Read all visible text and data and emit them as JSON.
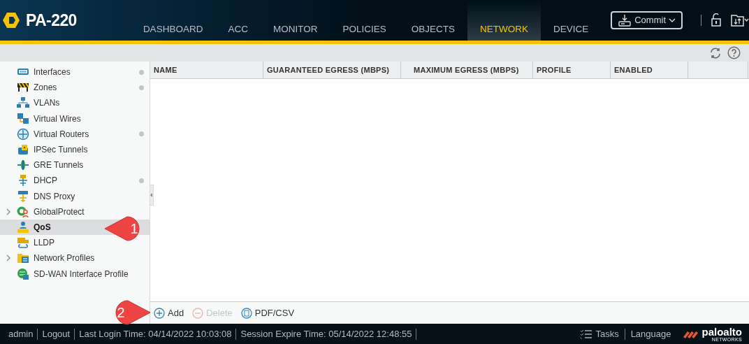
{
  "header": {
    "device": "PA-220",
    "tabs": [
      {
        "label": "DASHBOARD",
        "selected": false
      },
      {
        "label": "ACC",
        "selected": false
      },
      {
        "label": "MONITOR",
        "selected": false
      },
      {
        "label": "POLICIES",
        "selected": false
      },
      {
        "label": "OBJECTS",
        "selected": false
      },
      {
        "label": "NETWORK",
        "selected": true
      },
      {
        "label": "DEVICE",
        "selected": false
      }
    ],
    "commit": "Commit"
  },
  "sidebar": {
    "items": [
      {
        "label": "Interfaces",
        "selected": false,
        "expandable": false,
        "dot": true
      },
      {
        "label": "Zones",
        "selected": false,
        "expandable": false,
        "dot": true
      },
      {
        "label": "VLANs",
        "selected": false,
        "expandable": false,
        "dot": false
      },
      {
        "label": "Virtual Wires",
        "selected": false,
        "expandable": false,
        "dot": false
      },
      {
        "label": "Virtual Routers",
        "selected": false,
        "expandable": false,
        "dot": true
      },
      {
        "label": "IPSec Tunnels",
        "selected": false,
        "expandable": false,
        "dot": false
      },
      {
        "label": "GRE Tunnels",
        "selected": false,
        "expandable": false,
        "dot": false
      },
      {
        "label": "DHCP",
        "selected": false,
        "expandable": false,
        "dot": true
      },
      {
        "label": "DNS Proxy",
        "selected": false,
        "expandable": false,
        "dot": false
      },
      {
        "label": "GlobalProtect",
        "selected": false,
        "expandable": true,
        "dot": false
      },
      {
        "label": "QoS",
        "selected": true,
        "expandable": false,
        "dot": false
      },
      {
        "label": "LLDP",
        "selected": false,
        "expandable": false,
        "dot": false
      },
      {
        "label": "Network Profiles",
        "selected": false,
        "expandable": true,
        "dot": false
      },
      {
        "label": "SD-WAN Interface Profile",
        "selected": false,
        "expandable": false,
        "dot": false
      }
    ]
  },
  "table": {
    "columns": [
      "NAME",
      "GUARANTEED EGRESS (MBPS)",
      "MAXIMUM EGRESS (MBPS)",
      "PROFILE",
      "ENABLED"
    ]
  },
  "actions": [
    {
      "kind": "add",
      "label": "Add",
      "disabled": false
    },
    {
      "kind": "delete",
      "label": "Delete",
      "disabled": true
    },
    {
      "kind": "export",
      "label": "PDF/CSV",
      "disabled": false
    }
  ],
  "callouts": [
    {
      "label": "1"
    },
    {
      "label": "2"
    }
  ],
  "status_bar": {
    "left": [
      "admin",
      "Logout",
      "Last Login Time: 04/14/2022 10:03:08",
      "Session Expire Time: 05/14/2022 12:48:55"
    ],
    "tasks": "Tasks",
    "language": "Language",
    "brand": "paloalto",
    "brand_sub": "NETWORKS"
  }
}
